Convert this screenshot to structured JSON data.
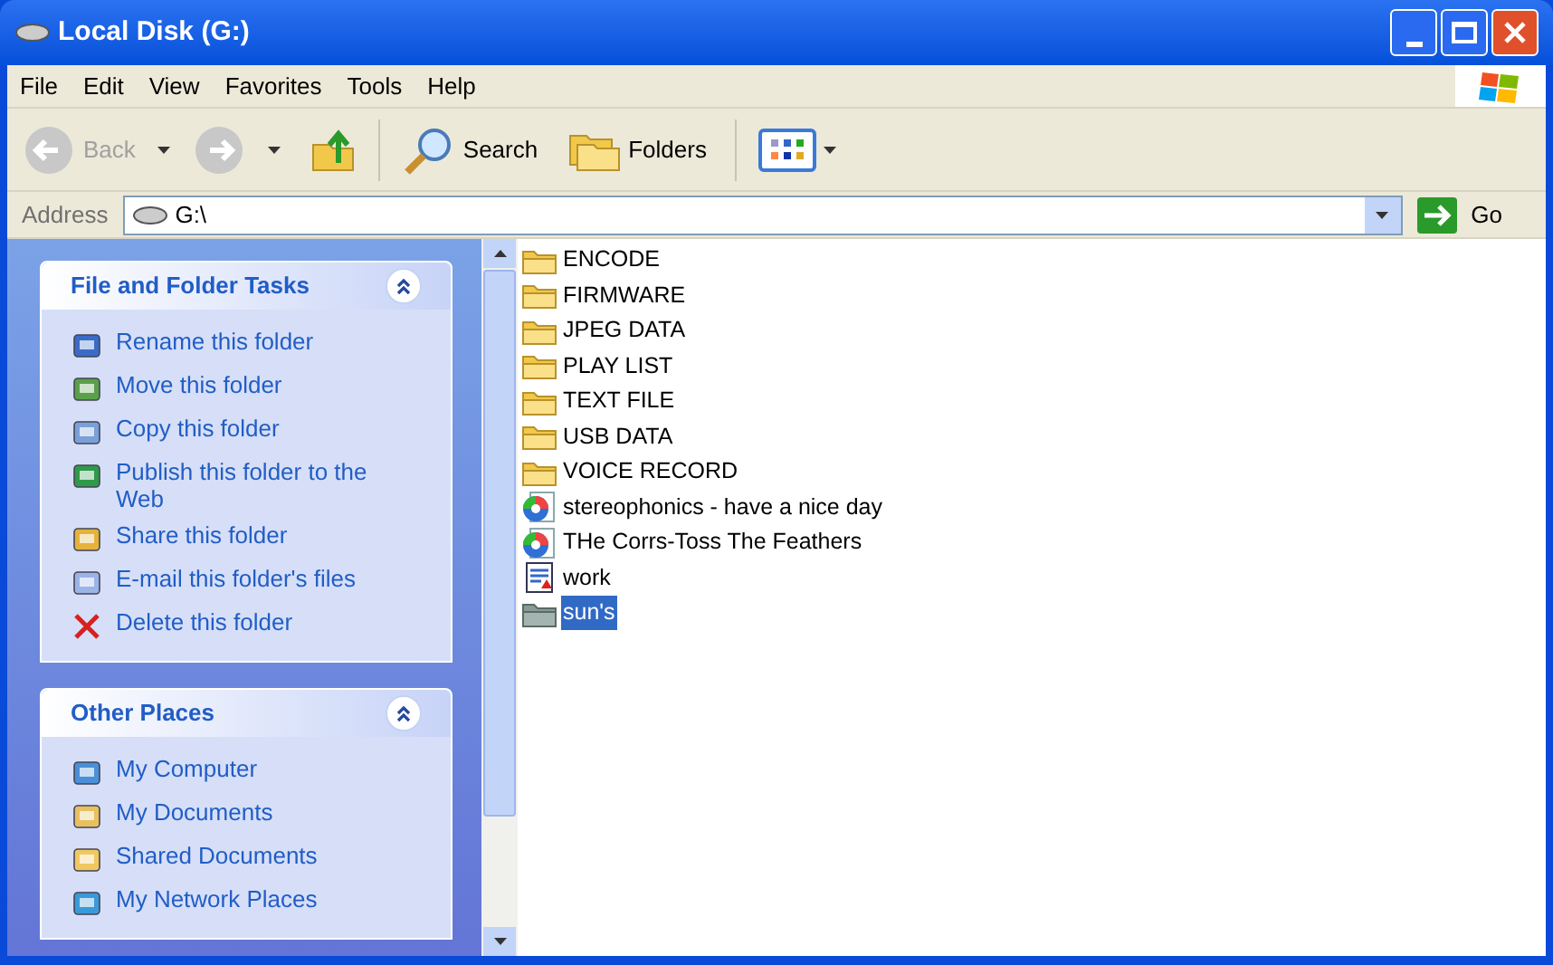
{
  "window": {
    "title": "Local Disk (G:)"
  },
  "menu": [
    "File",
    "Edit",
    "View",
    "Favorites",
    "Tools",
    "Help"
  ],
  "toolbar": {
    "back": {
      "label": "Back",
      "disabled": true
    },
    "forward": {
      "disabled": true
    },
    "search": "Search",
    "folders": "Folders"
  },
  "address": {
    "label": "Address",
    "value": "G:\\",
    "go": "Go"
  },
  "task_panels": [
    {
      "title": "File and Folder Tasks",
      "expanded": true,
      "items": [
        "Rename this folder",
        "Move this folder",
        "Copy this folder",
        "Publish this folder to the Web",
        "Share this folder",
        "E-mail this folder's files",
        "Delete this folder"
      ]
    },
    {
      "title": "Other Places",
      "expanded": true,
      "items": [
        "My Computer",
        "My Documents",
        "Shared Documents",
        "My Network Places"
      ]
    }
  ],
  "files": [
    {
      "name": "ENCODE",
      "kind": "folder",
      "selected": false
    },
    {
      "name": "FIRMWARE",
      "kind": "folder",
      "selected": false
    },
    {
      "name": "JPEG DATA",
      "kind": "folder",
      "selected": false
    },
    {
      "name": "PLAY LIST",
      "kind": "folder",
      "selected": false
    },
    {
      "name": "TEXT FILE",
      "kind": "folder",
      "selected": false
    },
    {
      "name": "USB DATA",
      "kind": "folder",
      "selected": false
    },
    {
      "name": "VOICE RECORD",
      "kind": "folder",
      "selected": false
    },
    {
      "name": "stereophonics - have a nice day",
      "kind": "media",
      "selected": false
    },
    {
      "name": "THe Corrs-Toss The Feathers",
      "kind": "media",
      "selected": false
    },
    {
      "name": "work",
      "kind": "document",
      "selected": false
    },
    {
      "name": "sun's",
      "kind": "folder",
      "selected": true
    }
  ]
}
